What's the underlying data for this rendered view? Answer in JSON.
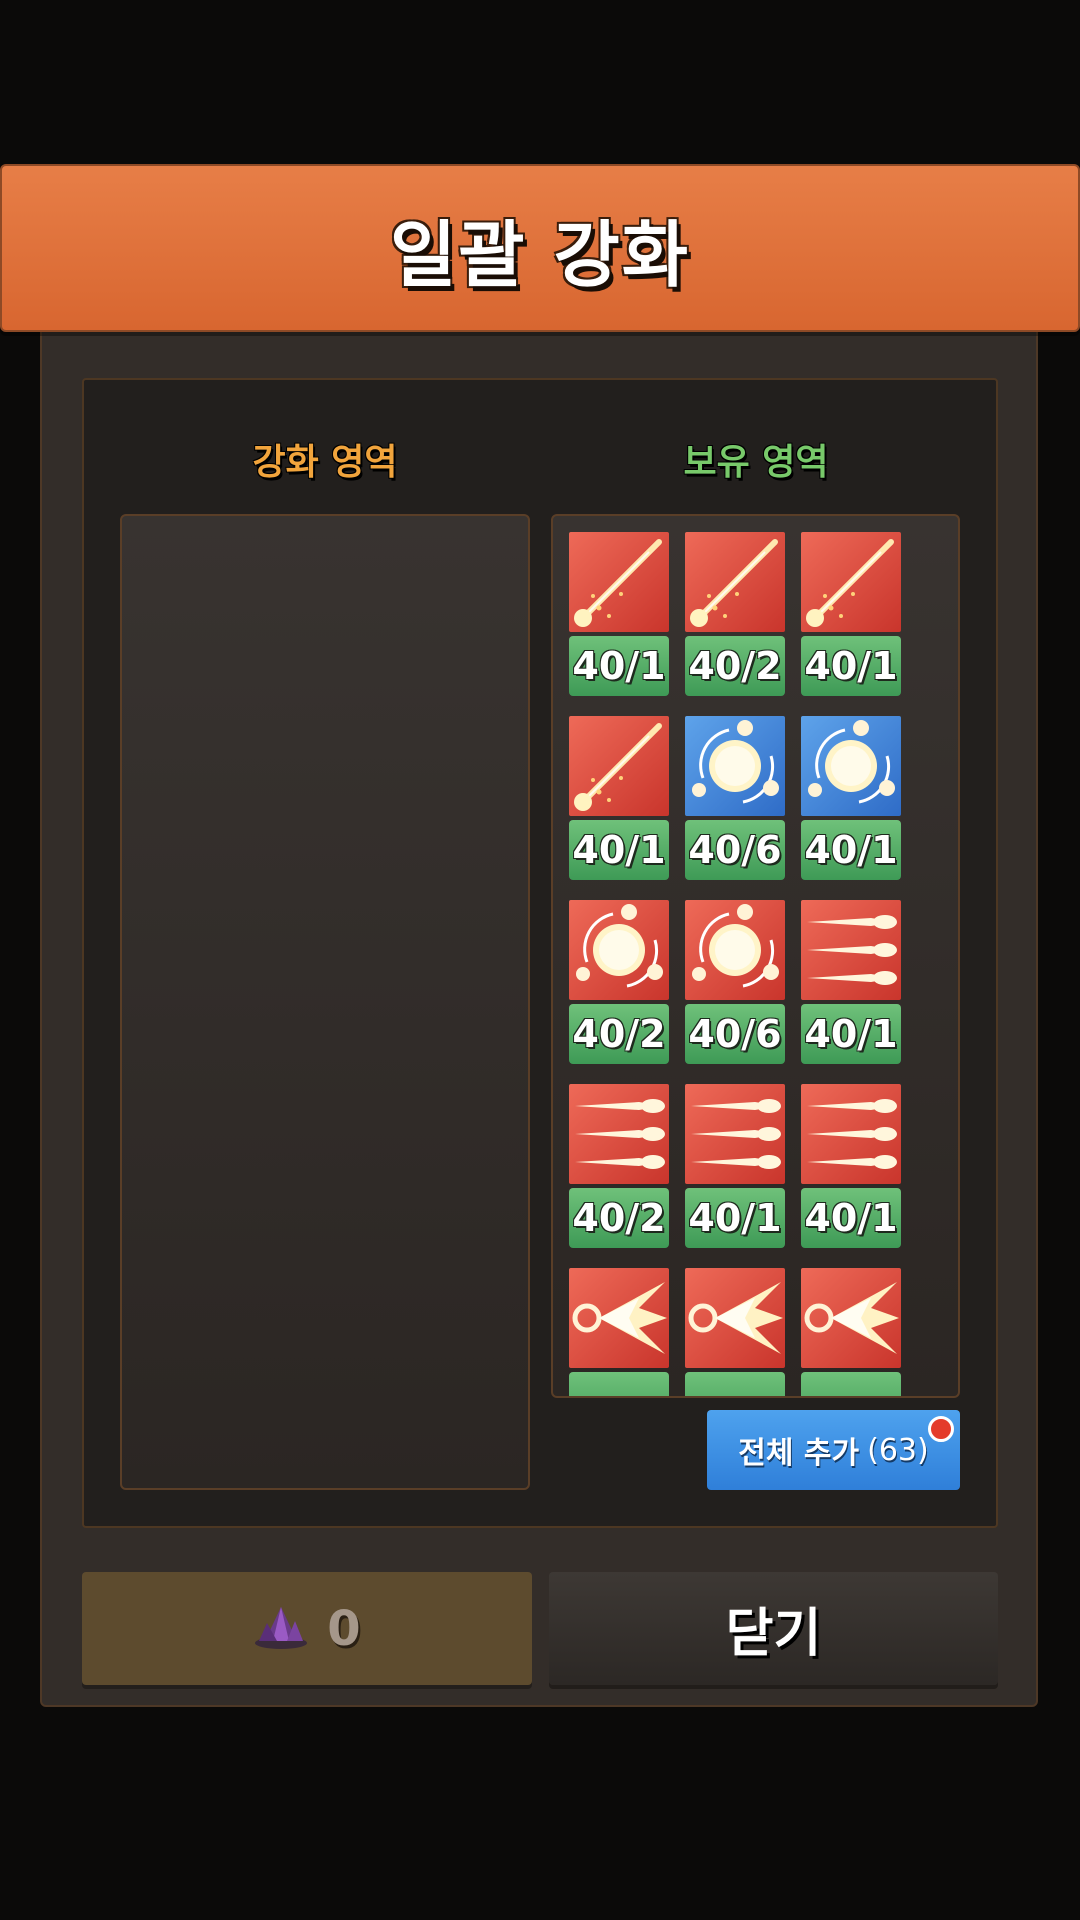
{
  "header": {
    "title": "일괄 강화"
  },
  "enhance_area": {
    "label": "강화 영역"
  },
  "holding_area": {
    "label": "보유 영역",
    "items": [
      {
        "icon": "slash-strike-icon",
        "color": "red",
        "level": "40/1"
      },
      {
        "icon": "slash-strike-icon",
        "color": "red",
        "level": "40/2"
      },
      {
        "icon": "slash-strike-icon",
        "color": "red",
        "level": "40/1"
      },
      {
        "icon": "slash-strike-icon",
        "color": "red",
        "level": "40/1"
      },
      {
        "icon": "orbit-sun-icon",
        "color": "blue",
        "level": "40/6"
      },
      {
        "icon": "orbit-sun-icon",
        "color": "blue",
        "level": "40/1"
      },
      {
        "icon": "orbit-sun-icon",
        "color": "red",
        "level": "40/2"
      },
      {
        "icon": "orbit-sun-icon",
        "color": "red",
        "level": "40/6"
      },
      {
        "icon": "triple-missile-icon",
        "color": "red",
        "level": "40/1"
      },
      {
        "icon": "triple-missile-icon",
        "color": "red",
        "level": "40/2"
      },
      {
        "icon": "triple-missile-icon",
        "color": "red",
        "level": "40/1"
      },
      {
        "icon": "triple-missile-icon",
        "color": "red",
        "level": "40/1"
      },
      {
        "icon": "burst-blast-icon",
        "color": "red",
        "level": ""
      },
      {
        "icon": "burst-blast-icon",
        "color": "red",
        "level": ""
      },
      {
        "icon": "burst-blast-icon",
        "color": "red",
        "level": ""
      }
    ]
  },
  "add_all_button": {
    "label": "전체 추가",
    "count": "(63)"
  },
  "cost_button": {
    "icon": "purple-crystal-icon",
    "value": "0"
  },
  "close_button": {
    "label": "닫기"
  },
  "colors": {
    "header": "#e07040",
    "level_badge": "#4fa862",
    "add_all": "#3a8ee3",
    "red_tile": "#d8473a",
    "blue_tile": "#4689db"
  }
}
